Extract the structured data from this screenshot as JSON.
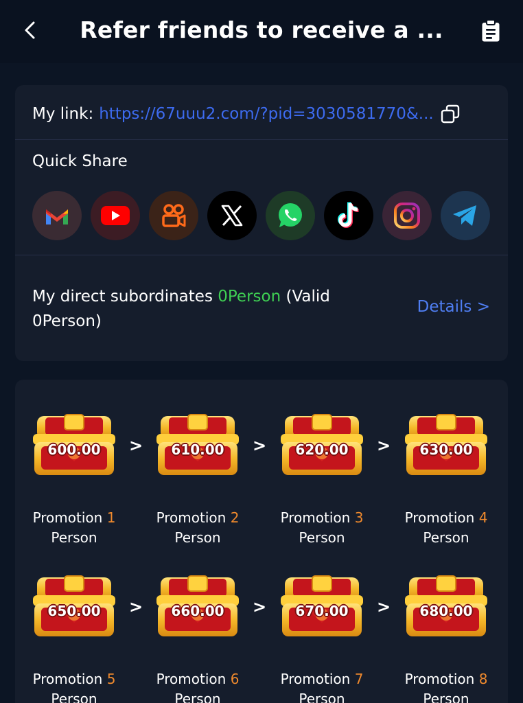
{
  "header": {
    "title": "Refer friends to receive a ...",
    "back_icon": "chevron-left-icon",
    "action_icon": "clipboard-icon"
  },
  "link": {
    "label": "My link:",
    "url": "https://67uuu2.com/?pid=3030581770&...",
    "copy_icon": "copy-icon"
  },
  "quick_share": {
    "label": "Quick Share",
    "icons": [
      "gmail-icon",
      "youtube-icon",
      "kuaishou-icon",
      "x-icon",
      "whatsapp-icon",
      "tiktok-icon",
      "instagram-icon",
      "telegram-icon"
    ]
  },
  "subordinates": {
    "prefix": "My direct subordinates ",
    "count": "0Person",
    "middle": " (Valid ",
    "valid": "0Person)",
    "details": "Details >"
  },
  "rewards": [
    {
      "amount": "600.00",
      "label": "Promotion",
      "num": "1",
      "unit": "Person"
    },
    {
      "amount": "610.00",
      "label": "Promotion",
      "num": "2",
      "unit": "Person"
    },
    {
      "amount": "620.00",
      "label": "Promotion",
      "num": "3",
      "unit": "Person"
    },
    {
      "amount": "630.00",
      "label": "Promotion",
      "num": "4",
      "unit": "Person"
    },
    {
      "amount": "650.00",
      "label": "Promotion",
      "num": "5",
      "unit": "Person"
    },
    {
      "amount": "660.00",
      "label": "Promotion",
      "num": "6",
      "unit": "Person"
    },
    {
      "amount": "670.00",
      "label": "Promotion",
      "num": "7",
      "unit": "Person"
    },
    {
      "amount": "680.00",
      "label": "Promotion",
      "num": "8",
      "unit": "Person"
    }
  ],
  "arrow": ">",
  "colors": {
    "background": "#0c1524",
    "card": "#151d2c",
    "link": "#3d6bf0",
    "green": "#3fcf53",
    "orange": "#f08a2d",
    "details": "#4f7ef2"
  }
}
